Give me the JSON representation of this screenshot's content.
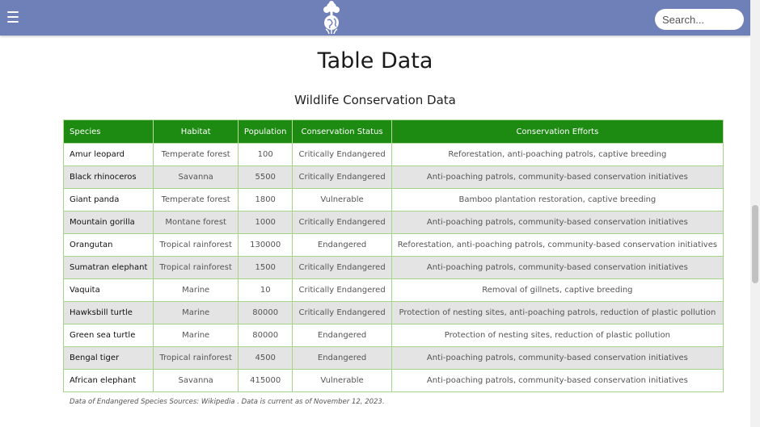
{
  "header": {
    "menu_icon": "hamburger-menu-icon",
    "logo_icon": "globe-tree-logo",
    "search": {
      "placeholder": "Search..."
    },
    "colors": {
      "bar": "#6f7fb8"
    }
  },
  "main": {
    "title": "Table Data",
    "table_caption": "Wildlife Conservation Data",
    "table": {
      "headers": [
        "Species",
        "Habitat",
        "Population",
        "Conservation Status",
        "Conservation Efforts"
      ],
      "rows": [
        [
          "Amur leopard",
          "Temperate forest",
          "100",
          "Critically Endangered",
          "Reforestation, anti-poaching patrols, captive breeding"
        ],
        [
          "Black rhinoceros",
          "Savanna",
          "5500",
          "Critically Endangered",
          "Anti-poaching patrols, community-based conservation initiatives"
        ],
        [
          "Giant panda",
          "Temperate forest",
          "1800",
          "Vulnerable",
          "Bamboo plantation restoration, captive breeding"
        ],
        [
          "Mountain gorilla",
          "Montane forest",
          "1000",
          "Critically Endangered",
          "Anti-poaching patrols, community-based conservation initiatives"
        ],
        [
          "Orangutan",
          "Tropical rainforest",
          "130000",
          "Endangered",
          "Reforestation, anti-poaching patrols, community-based conservation initiatives"
        ],
        [
          "Sumatran elephant",
          "Tropical rainforest",
          "1500",
          "Critically Endangered",
          "Anti-poaching patrols, community-based conservation initiatives"
        ],
        [
          "Vaquita",
          "Marine",
          "10",
          "Critically Endangered",
          "Removal of gillnets, captive breeding"
        ],
        [
          "Hawksbill turtle",
          "Marine",
          "80000",
          "Critically Endangered",
          "Protection of nesting sites, anti-poaching patrols, reduction of plastic pollution"
        ],
        [
          "Green sea turtle",
          "Marine",
          "80000",
          "Endangered",
          "Protection of nesting sites, reduction of plastic pollution"
        ],
        [
          "Bengal tiger",
          "Tropical rainforest",
          "4500",
          "Endangered",
          "Anti-poaching patrols, community-based conservation initiatives"
        ],
        [
          "African elephant",
          "Savanna",
          "415000",
          "Vulnerable",
          "Anti-poaching patrols, community-based conservation initiatives"
        ]
      ],
      "colors": {
        "header_bg": "#1d8a12",
        "alt_row_bg": "#e4e4e4",
        "border": "#a6d38a"
      }
    },
    "footnote": "Data of Endangered Species Sources: Wikipedia . Data is current as of November 12, 2023."
  }
}
